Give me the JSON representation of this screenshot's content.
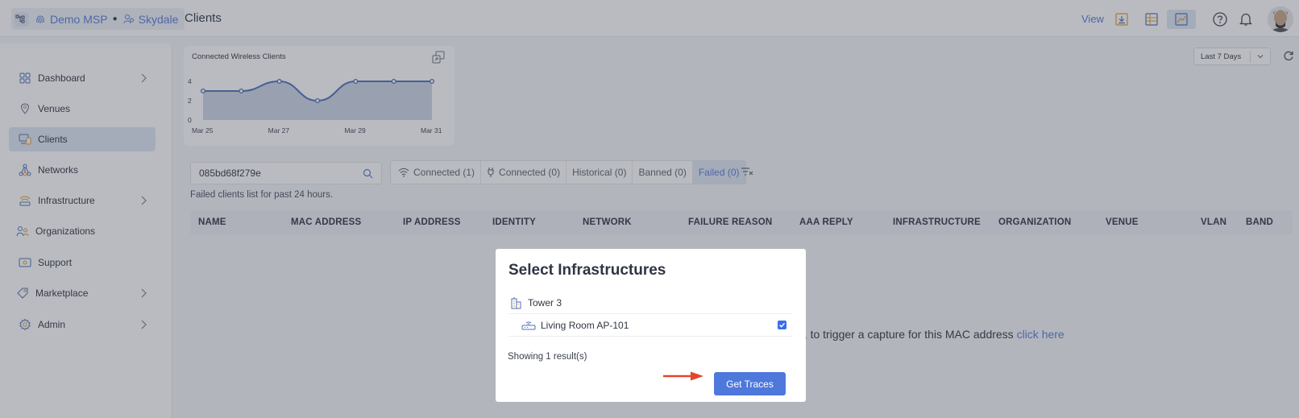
{
  "topbar": {
    "msp_label": "Demo MSP",
    "org_label": "Skydale",
    "page_title": "Clients",
    "view_label": "View",
    "icons": [
      "hierarchy-icon",
      "msp-fingerprint-icon",
      "org-people-icon",
      "view-download-icon",
      "view-map-icon",
      "view-chart-icon",
      "help-icon",
      "bell-icon",
      "avatar"
    ]
  },
  "sidebar": {
    "items": [
      {
        "label": "Dashboard",
        "icon": "grid-icon",
        "has_chevron": true
      },
      {
        "label": "Venues",
        "icon": "location-pin-icon",
        "has_chevron": false
      },
      {
        "label": "Clients",
        "icon": "devices-icon",
        "has_chevron": false,
        "active": true
      },
      {
        "label": "Networks",
        "icon": "network-icon",
        "has_chevron": false
      },
      {
        "label": "Infrastructure",
        "icon": "wifi-tower-icon",
        "has_chevron": true
      },
      {
        "label": "Organizations",
        "icon": "people-icon",
        "has_chevron": false
      },
      {
        "label": "Support",
        "icon": "ticket-icon",
        "has_chevron": false
      },
      {
        "label": "Marketplace",
        "icon": "tag-icon",
        "has_chevron": true
      },
      {
        "label": "Admin",
        "icon": "gear-icon",
        "has_chevron": true
      }
    ]
  },
  "chart": {
    "title": "Connected Wireless Clients"
  },
  "chart_data": {
    "type": "area",
    "title": "Connected Wireless Clients",
    "x": [
      "Mar 25",
      "Mar 26",
      "Mar 27",
      "Mar 28",
      "Mar 29",
      "Mar 30",
      "Mar 31"
    ],
    "x_tick_labels": [
      "Mar 25",
      "Mar 27",
      "Mar 29",
      "Mar 31"
    ],
    "values": [
      3,
      3,
      4,
      2,
      4,
      4,
      4
    ],
    "y_ticks": [
      0,
      2,
      4
    ],
    "ylim": [
      0,
      4
    ],
    "color": "#4e6fb8",
    "fill": "#cdd5e6"
  },
  "range_select": {
    "value": "Last 7 Days"
  },
  "search": {
    "value": "085bd68f279e"
  },
  "tabs": [
    {
      "label": "Connected (1)",
      "icon": "wifi-icon"
    },
    {
      "label": "Connected (0)",
      "icon": "plug-icon"
    },
    {
      "label": "Historical (0)"
    },
    {
      "label": "Banned (0)"
    },
    {
      "label": "Failed (0)",
      "active": true
    }
  ],
  "sub_note": "Failed clients list for past 24 hours.",
  "table": {
    "columns": [
      "NAME",
      "MAC ADDRESS",
      "IP ADDRESS",
      "IDENTITY",
      "NETWORK",
      "FAILURE REASON",
      "AAA REPLY",
      "INFRASTRUCTURE",
      "ORGANIZATION",
      "VENUE",
      "VLAN",
      "BAND"
    ]
  },
  "empty": {
    "text": "d, to trigger a capture for this MAC address ",
    "link": "click here"
  },
  "modal": {
    "title": "Select Infrastructures",
    "venue": "Tower 3",
    "device": "Living Room AP-101",
    "device_checked": true,
    "showing": "Showing 1 result(s)",
    "button": "Get Traces"
  },
  "colors": {
    "accent": "#5a7bd8",
    "button": "#4e78dc",
    "arrow": "#e5452a"
  }
}
